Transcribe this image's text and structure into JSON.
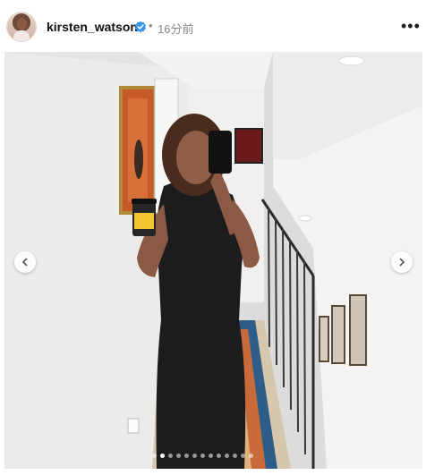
{
  "post": {
    "username": "kirsten_watson",
    "separator": "•",
    "time": "16分前",
    "more_label": "•••",
    "verified_color": "#3897f0"
  },
  "carousel": {
    "total_slides": 13,
    "active_index": 1
  }
}
